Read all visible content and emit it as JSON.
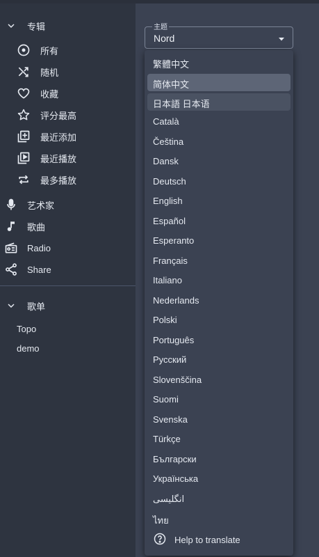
{
  "sidebar": {
    "albums_header": "专辑",
    "albums_items": [
      {
        "label": "所有",
        "icon": "album-icon"
      },
      {
        "label": "随机",
        "icon": "shuffle-icon"
      },
      {
        "label": "收藏",
        "icon": "heart-icon"
      },
      {
        "label": "评分最高",
        "icon": "star-icon"
      },
      {
        "label": "最近添加",
        "icon": "library-add-icon"
      },
      {
        "label": "最近播放",
        "icon": "library-play-icon"
      },
      {
        "label": "最多播放",
        "icon": "repeat-icon"
      }
    ],
    "nav_items": [
      {
        "label": "艺术家",
        "icon": "microphone-icon"
      },
      {
        "label": "歌曲",
        "icon": "music-note-icon"
      },
      {
        "label": "Radio",
        "icon": "radio-icon"
      },
      {
        "label": "Share",
        "icon": "share-icon"
      }
    ],
    "playlists_header": "歌单",
    "playlists": [
      "Topo",
      "demo"
    ]
  },
  "theme_select": {
    "label": "主题",
    "value": "Nord",
    "caret_icon": "caret-down-icon"
  },
  "language_menu": {
    "items": [
      "繁體中文",
      "简体中文",
      "日本語 日本语",
      "Català",
      "Čeština",
      "Dansk",
      "Deutsch",
      "English",
      "Español",
      "Esperanto",
      "Français",
      "Italiano",
      "Nederlands",
      "Polski",
      "Português",
      "Русский",
      "Slovenščina",
      "Suomi",
      "Svenska",
      "Türkçe",
      "Български",
      "Українська",
      "انگلیسی",
      "ไทย"
    ],
    "selected": "简体中文",
    "hovered": "日本語 日本语",
    "help_label": "Help to translate",
    "help_icon": "help-circle-icon"
  },
  "colors": {
    "sidebar_bg": "#2e3440",
    "main_bg": "#3b4252",
    "text": "#e5e9f0",
    "selected_bg": "#5d6576"
  }
}
